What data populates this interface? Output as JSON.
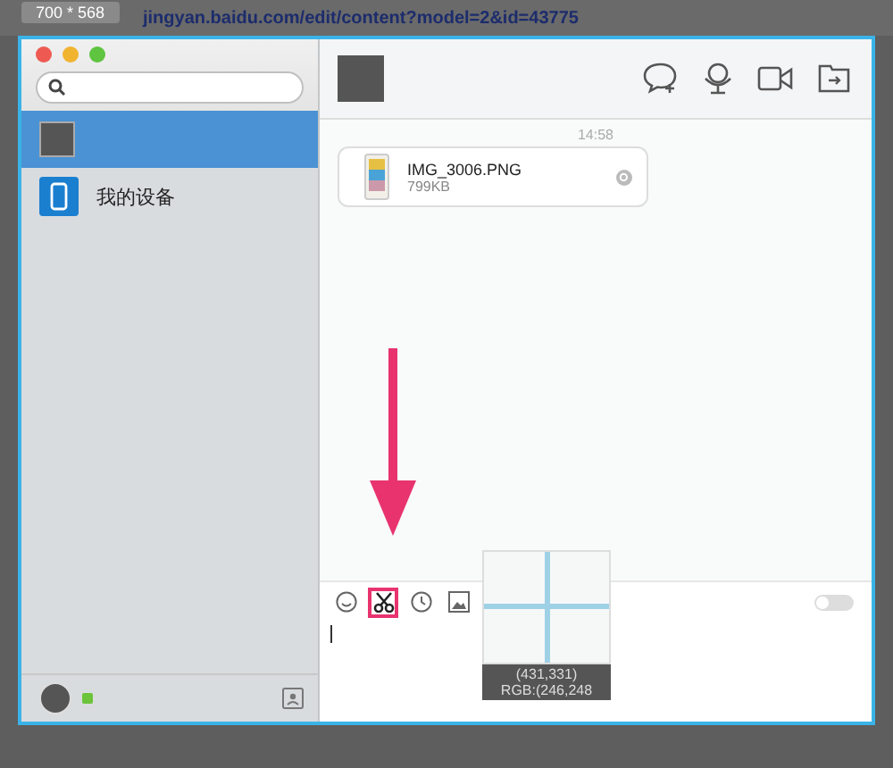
{
  "capture_size": "700 * 568",
  "browser": {
    "url": "jingyan.baidu.com/edit/content?model=2&id=43775"
  },
  "sidebar": {
    "items": [
      {
        "kind": "contact",
        "selected": true
      },
      {
        "kind": "device",
        "label": "我的设备",
        "selected": false
      }
    ]
  },
  "chat": {
    "time": "14:58",
    "file": {
      "name": "IMG_3006.PNG",
      "size": "799KB"
    }
  },
  "toolbar": {
    "tools": [
      {
        "kind": "smiley",
        "selected": false
      },
      {
        "kind": "scissors",
        "selected": true
      },
      {
        "kind": "history",
        "selected": false
      },
      {
        "kind": "image",
        "selected": false
      }
    ],
    "toggle_on": false
  },
  "magnifier": {
    "coords": "(431,331)",
    "pixel_value": "RGB:(246,248"
  }
}
